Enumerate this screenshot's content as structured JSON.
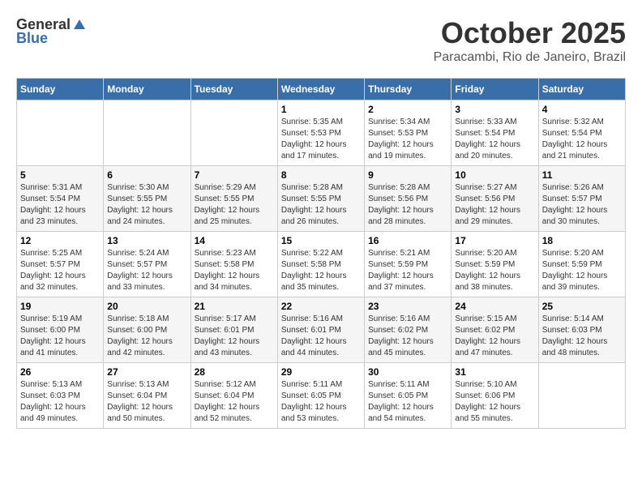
{
  "header": {
    "logo_general": "General",
    "logo_blue": "Blue",
    "month_year": "October 2025",
    "location": "Paracambi, Rio de Janeiro, Brazil"
  },
  "days_of_week": [
    "Sunday",
    "Monday",
    "Tuesday",
    "Wednesday",
    "Thursday",
    "Friday",
    "Saturday"
  ],
  "weeks": [
    [
      {
        "day": "",
        "info": ""
      },
      {
        "day": "",
        "info": ""
      },
      {
        "day": "",
        "info": ""
      },
      {
        "day": "1",
        "info": "Sunrise: 5:35 AM\nSunset: 5:53 PM\nDaylight: 12 hours\nand 17 minutes."
      },
      {
        "day": "2",
        "info": "Sunrise: 5:34 AM\nSunset: 5:53 PM\nDaylight: 12 hours\nand 19 minutes."
      },
      {
        "day": "3",
        "info": "Sunrise: 5:33 AM\nSunset: 5:54 PM\nDaylight: 12 hours\nand 20 minutes."
      },
      {
        "day": "4",
        "info": "Sunrise: 5:32 AM\nSunset: 5:54 PM\nDaylight: 12 hours\nand 21 minutes."
      }
    ],
    [
      {
        "day": "5",
        "info": "Sunrise: 5:31 AM\nSunset: 5:54 PM\nDaylight: 12 hours\nand 23 minutes."
      },
      {
        "day": "6",
        "info": "Sunrise: 5:30 AM\nSunset: 5:55 PM\nDaylight: 12 hours\nand 24 minutes."
      },
      {
        "day": "7",
        "info": "Sunrise: 5:29 AM\nSunset: 5:55 PM\nDaylight: 12 hours\nand 25 minutes."
      },
      {
        "day": "8",
        "info": "Sunrise: 5:28 AM\nSunset: 5:55 PM\nDaylight: 12 hours\nand 26 minutes."
      },
      {
        "day": "9",
        "info": "Sunrise: 5:28 AM\nSunset: 5:56 PM\nDaylight: 12 hours\nand 28 minutes."
      },
      {
        "day": "10",
        "info": "Sunrise: 5:27 AM\nSunset: 5:56 PM\nDaylight: 12 hours\nand 29 minutes."
      },
      {
        "day": "11",
        "info": "Sunrise: 5:26 AM\nSunset: 5:57 PM\nDaylight: 12 hours\nand 30 minutes."
      }
    ],
    [
      {
        "day": "12",
        "info": "Sunrise: 5:25 AM\nSunset: 5:57 PM\nDaylight: 12 hours\nand 32 minutes."
      },
      {
        "day": "13",
        "info": "Sunrise: 5:24 AM\nSunset: 5:57 PM\nDaylight: 12 hours\nand 33 minutes."
      },
      {
        "day": "14",
        "info": "Sunrise: 5:23 AM\nSunset: 5:58 PM\nDaylight: 12 hours\nand 34 minutes."
      },
      {
        "day": "15",
        "info": "Sunrise: 5:22 AM\nSunset: 5:58 PM\nDaylight: 12 hours\nand 35 minutes."
      },
      {
        "day": "16",
        "info": "Sunrise: 5:21 AM\nSunset: 5:59 PM\nDaylight: 12 hours\nand 37 minutes."
      },
      {
        "day": "17",
        "info": "Sunrise: 5:20 AM\nSunset: 5:59 PM\nDaylight: 12 hours\nand 38 minutes."
      },
      {
        "day": "18",
        "info": "Sunrise: 5:20 AM\nSunset: 5:59 PM\nDaylight: 12 hours\nand 39 minutes."
      }
    ],
    [
      {
        "day": "19",
        "info": "Sunrise: 5:19 AM\nSunset: 6:00 PM\nDaylight: 12 hours\nand 41 minutes."
      },
      {
        "day": "20",
        "info": "Sunrise: 5:18 AM\nSunset: 6:00 PM\nDaylight: 12 hours\nand 42 minutes."
      },
      {
        "day": "21",
        "info": "Sunrise: 5:17 AM\nSunset: 6:01 PM\nDaylight: 12 hours\nand 43 minutes."
      },
      {
        "day": "22",
        "info": "Sunrise: 5:16 AM\nSunset: 6:01 PM\nDaylight: 12 hours\nand 44 minutes."
      },
      {
        "day": "23",
        "info": "Sunrise: 5:16 AM\nSunset: 6:02 PM\nDaylight: 12 hours\nand 45 minutes."
      },
      {
        "day": "24",
        "info": "Sunrise: 5:15 AM\nSunset: 6:02 PM\nDaylight: 12 hours\nand 47 minutes."
      },
      {
        "day": "25",
        "info": "Sunrise: 5:14 AM\nSunset: 6:03 PM\nDaylight: 12 hours\nand 48 minutes."
      }
    ],
    [
      {
        "day": "26",
        "info": "Sunrise: 5:13 AM\nSunset: 6:03 PM\nDaylight: 12 hours\nand 49 minutes."
      },
      {
        "day": "27",
        "info": "Sunrise: 5:13 AM\nSunset: 6:04 PM\nDaylight: 12 hours\nand 50 minutes."
      },
      {
        "day": "28",
        "info": "Sunrise: 5:12 AM\nSunset: 6:04 PM\nDaylight: 12 hours\nand 52 minutes."
      },
      {
        "day": "29",
        "info": "Sunrise: 5:11 AM\nSunset: 6:05 PM\nDaylight: 12 hours\nand 53 minutes."
      },
      {
        "day": "30",
        "info": "Sunrise: 5:11 AM\nSunset: 6:05 PM\nDaylight: 12 hours\nand 54 minutes."
      },
      {
        "day": "31",
        "info": "Sunrise: 5:10 AM\nSunset: 6:06 PM\nDaylight: 12 hours\nand 55 minutes."
      },
      {
        "day": "",
        "info": ""
      }
    ]
  ]
}
